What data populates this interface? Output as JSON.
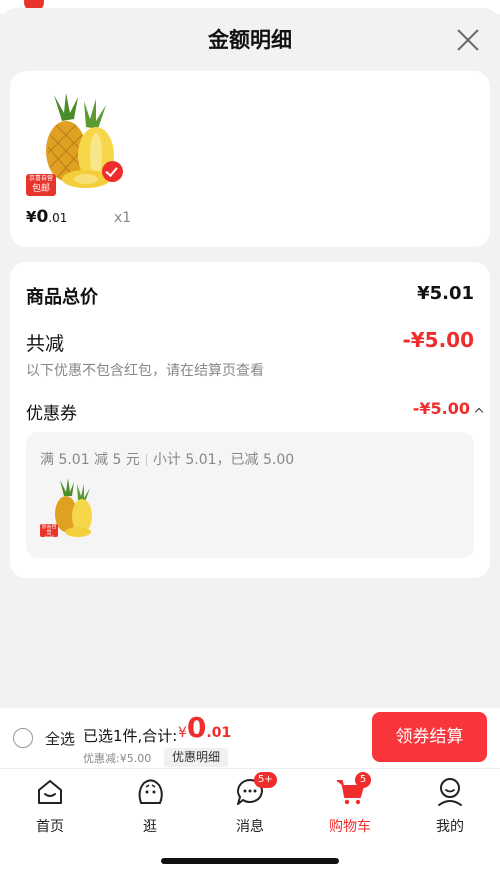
{
  "sheet": {
    "title": "金额明细"
  },
  "product": {
    "tag_top": "京喜自营",
    "tag_bottom": "包邮",
    "price_symbol": "¥",
    "price_int": "0",
    "price_dec": ".01",
    "quantity": "x1"
  },
  "summary": {
    "total_label": "商品总价",
    "total_value": "¥5.01",
    "reduce_label": "共减",
    "reduce_value": "-¥5.00",
    "note": "以下优惠不包含红包，请在结算页查看",
    "coupon_label": "优惠券",
    "coupon_value": "-¥5.00",
    "coupon_rule": "满 5.01 减 5 元",
    "coupon_subtotal": "小计 5.01，已减 5.00",
    "mini_tag_top": "京喜自营",
    "mini_tag_bottom": "包邮"
  },
  "checkout": {
    "select_all": "全选",
    "selected_info": "已选1件,合计:",
    "sum_symbol": "¥",
    "sum_int": "0",
    "sum_dec": ".01",
    "discount_note": "优惠减:¥5.00",
    "detail_label": "优惠明细",
    "button_label": "领券结算"
  },
  "tabs": [
    {
      "label": "首页",
      "icon": "home-icon"
    },
    {
      "label": "逛",
      "icon": "browse-face-icon"
    },
    {
      "label": "消息",
      "icon": "message-icon",
      "badge": "5+"
    },
    {
      "label": "购物车",
      "icon": "cart-icon",
      "badge": "5",
      "active": true
    },
    {
      "label": "我的",
      "icon": "profile-icon"
    }
  ],
  "colors": {
    "accent": "#f02d2d",
    "button": "#f8353a"
  }
}
